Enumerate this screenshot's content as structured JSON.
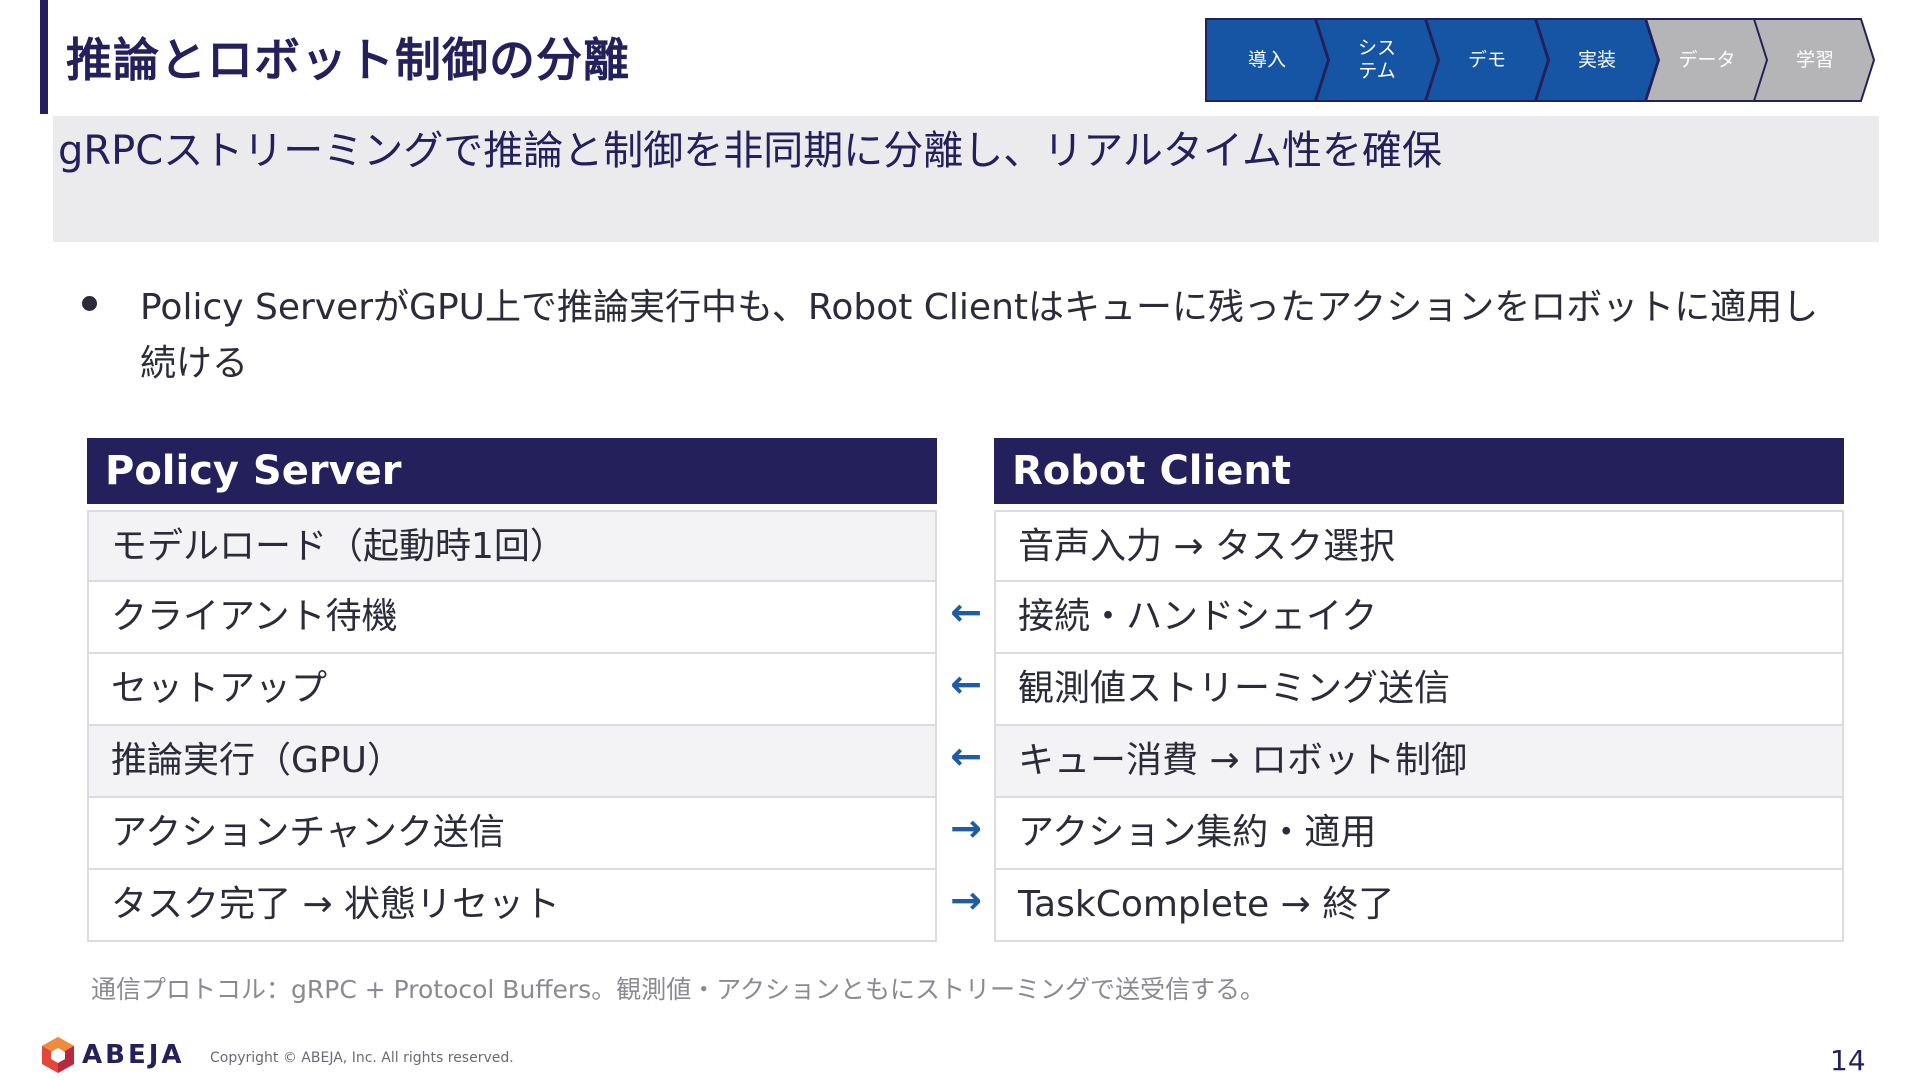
{
  "slide": {
    "title": "推論とロボット制御の分離",
    "subtitle": "gRPCストリーミングで推論と制御を非同期に分離し、リアルタイム性を確保",
    "bullet": "Policy ServerがGPU上で推論実行中も、Robot Clientはキューに残ったアクションをロボットに適用し続ける",
    "note": "通信プロトコル：gRPC + Protocol Buffers。観測値・アクションともにストリーミングで送受信する。",
    "page_number": "14"
  },
  "nav": {
    "steps": [
      {
        "label": "導入",
        "state": "active"
      },
      {
        "label": "シス\nテム",
        "state": "active"
      },
      {
        "label": "デモ",
        "state": "active"
      },
      {
        "label": "実装",
        "state": "active"
      },
      {
        "label": "データ",
        "state": "inactive"
      },
      {
        "label": "学習",
        "state": "inactive"
      }
    ],
    "active_color": "#1655a3",
    "inactive_color": "#b5b5b8"
  },
  "server": {
    "header": "Policy Server",
    "rows": [
      "モデルロード（起動時1回）",
      "クライアント待機",
      "セットアップ",
      "推論実行（GPU）",
      "アクションチャンク送信",
      "タスク完了 → 状態リセット"
    ]
  },
  "client": {
    "header": "Robot Client",
    "rows": [
      "音声入力 → タスク選択",
      "接続・ハンドシェイク",
      "観測値ストリーミング送信",
      "キュー消費 → ロボット制御",
      "アクション集約・適用",
      "TaskComplete → 終了"
    ]
  },
  "arrows": [
    "",
    "←",
    "←",
    "←",
    "→",
    "→"
  ],
  "footer": {
    "brand": "ABEJA",
    "copyright": "Copyright © ABEJA, Inc. All rights reserved."
  },
  "colors": {
    "navy": "#23205b",
    "arrow_blue": "#1f5ca3",
    "logo_red": "#e4473a"
  }
}
